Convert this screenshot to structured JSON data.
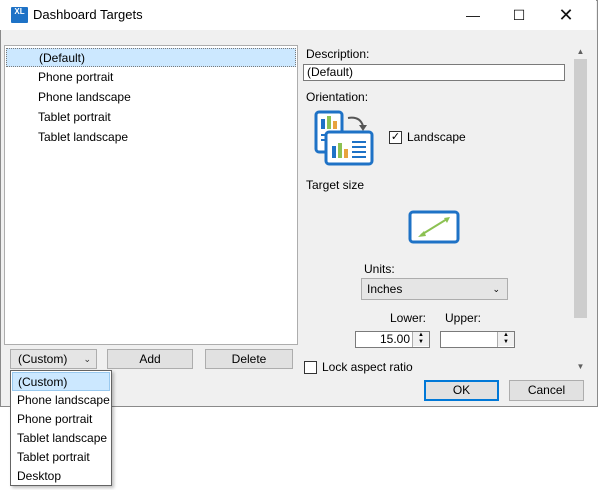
{
  "window": {
    "title": "Dashboard Targets",
    "app_icon_text": "XL",
    "controls": {
      "minimize": "—",
      "maximize": "☐",
      "close": "✕"
    }
  },
  "targets_list": {
    "items": [
      {
        "label": "(Default)",
        "selected": true
      },
      {
        "label": "Phone portrait",
        "selected": false
      },
      {
        "label": "Phone landscape",
        "selected": false
      },
      {
        "label": "Tablet portrait",
        "selected": false
      },
      {
        "label": "Tablet landscape",
        "selected": false
      }
    ]
  },
  "bottom": {
    "preset_combo_value": "(Custom)",
    "add_label": "Add",
    "delete_label": "Delete"
  },
  "preset_dropdown": {
    "options": [
      {
        "label": "(Custom)",
        "selected": true
      },
      {
        "label": "Phone landscape",
        "selected": false
      },
      {
        "label": "Phone portrait",
        "selected": false
      },
      {
        "label": "Tablet landscape",
        "selected": false
      },
      {
        "label": "Tablet portrait",
        "selected": false
      },
      {
        "label": "Desktop",
        "selected": false
      }
    ]
  },
  "details": {
    "description_label": "Description:",
    "description_value": "(Default)",
    "orientation_label": "Orientation:",
    "landscape_label": "Landscape",
    "landscape_checked": true,
    "target_size_label": "Target size",
    "units_label": "Units:",
    "units_value": "Inches",
    "lower_label": "Lower:",
    "lower_value": "15.00",
    "upper_label": "Upper:",
    "upper_value": "",
    "lock_aspect_label": "Lock aspect ratio",
    "lock_aspect_checked": false
  },
  "footer": {
    "ok_label": "OK",
    "cancel_label": "Cancel"
  },
  "colors": {
    "accent": "#0078d7",
    "selection": "#cce8ff",
    "icon_blue": "#1e72c6",
    "chart_green": "#8cc152",
    "chart_orange": "#e8a33d"
  }
}
